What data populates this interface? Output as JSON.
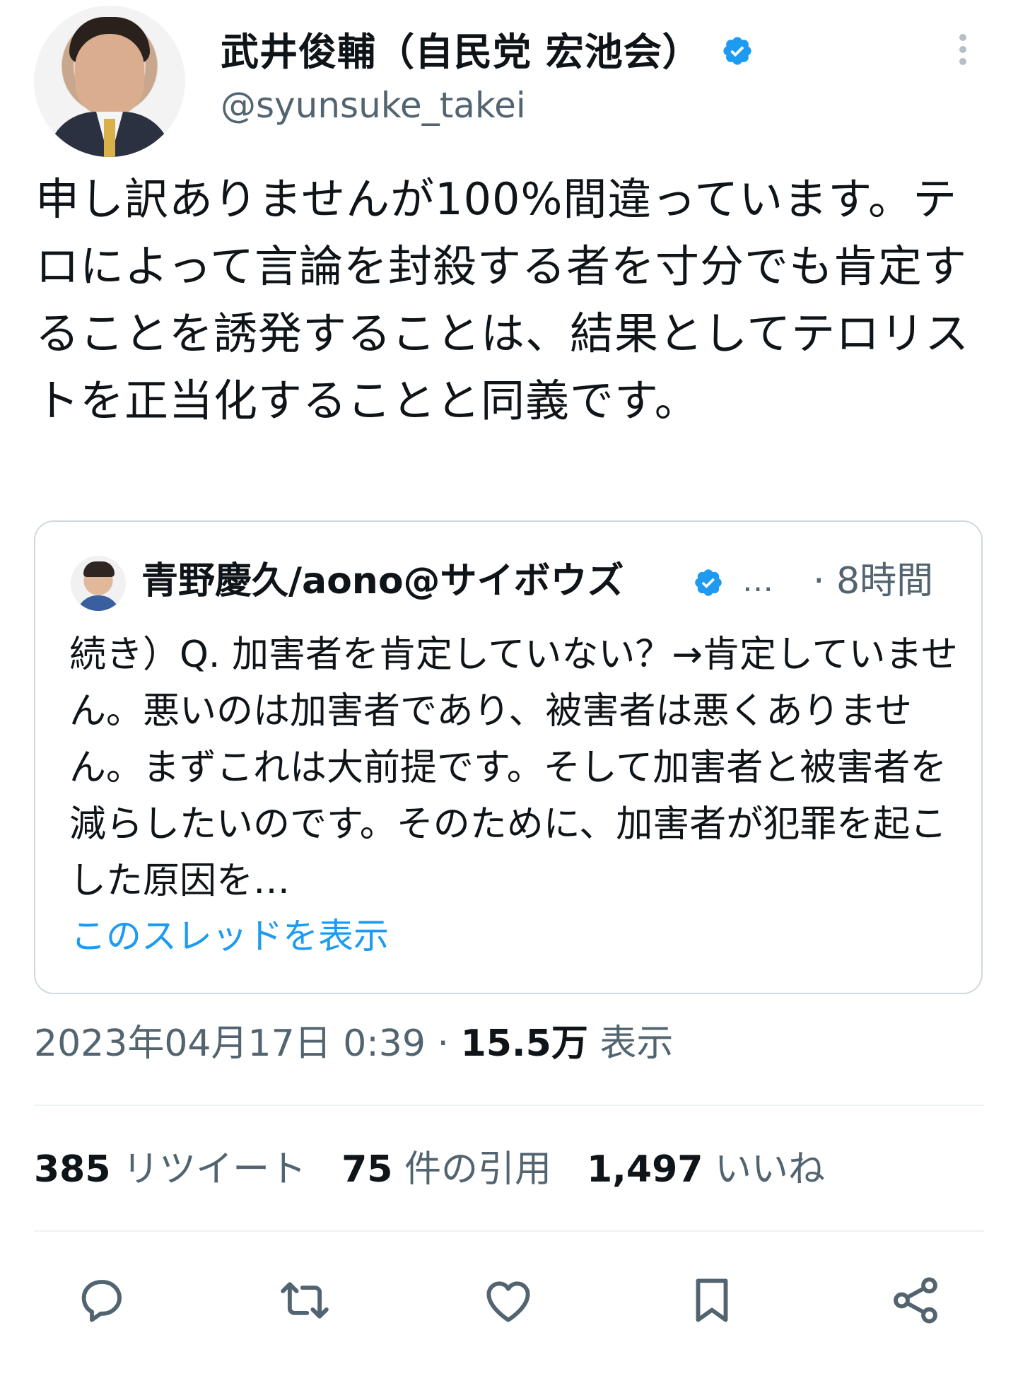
{
  "author": {
    "display_name": "武井俊輔（自民党 宏池会）",
    "handle": "@syunsuke_takei",
    "verified_color": "#1d9bf0"
  },
  "tweet": {
    "text": "申し訳ありませんが100%間違っています。テロによって言論を封殺する者を寸分でも肯定することを誘発することは、結果としてテロリストを正当化することと同義です。"
  },
  "quote": {
    "display_name": "青野慶久/aono@サイボウズ",
    "ellipsis": "…",
    "time": "· 8時間",
    "text": "続き）Q. 加害者を肯定していない？→肯定していません。悪いのは加害者であり、被害者は悪くありません。まずこれは大前提です。そして加害者と被害者を減らしたいのです。そのために、加害者が犯罪を起こした原因を…",
    "thread_link": "このスレッドを表示"
  },
  "meta": {
    "timestamp": "2023年04月17日 0:39 · ",
    "views_count": "15.5万",
    "views_label": " 表示"
  },
  "stats": {
    "retweets_count": "385",
    "retweets_label": " リツイート",
    "quotes_count": "75",
    "quotes_label": " 件の引用",
    "likes_count": "1,497",
    "likes_label": " いいね"
  },
  "actions": [
    "reply-icon",
    "retweet-icon",
    "like-icon",
    "bookmark-icon",
    "share-icon"
  ],
  "colors": {
    "text": "#0f1419",
    "secondary": "#536471",
    "link": "#1d9bf0",
    "border": "#cfd9de",
    "icon": "#536471"
  }
}
